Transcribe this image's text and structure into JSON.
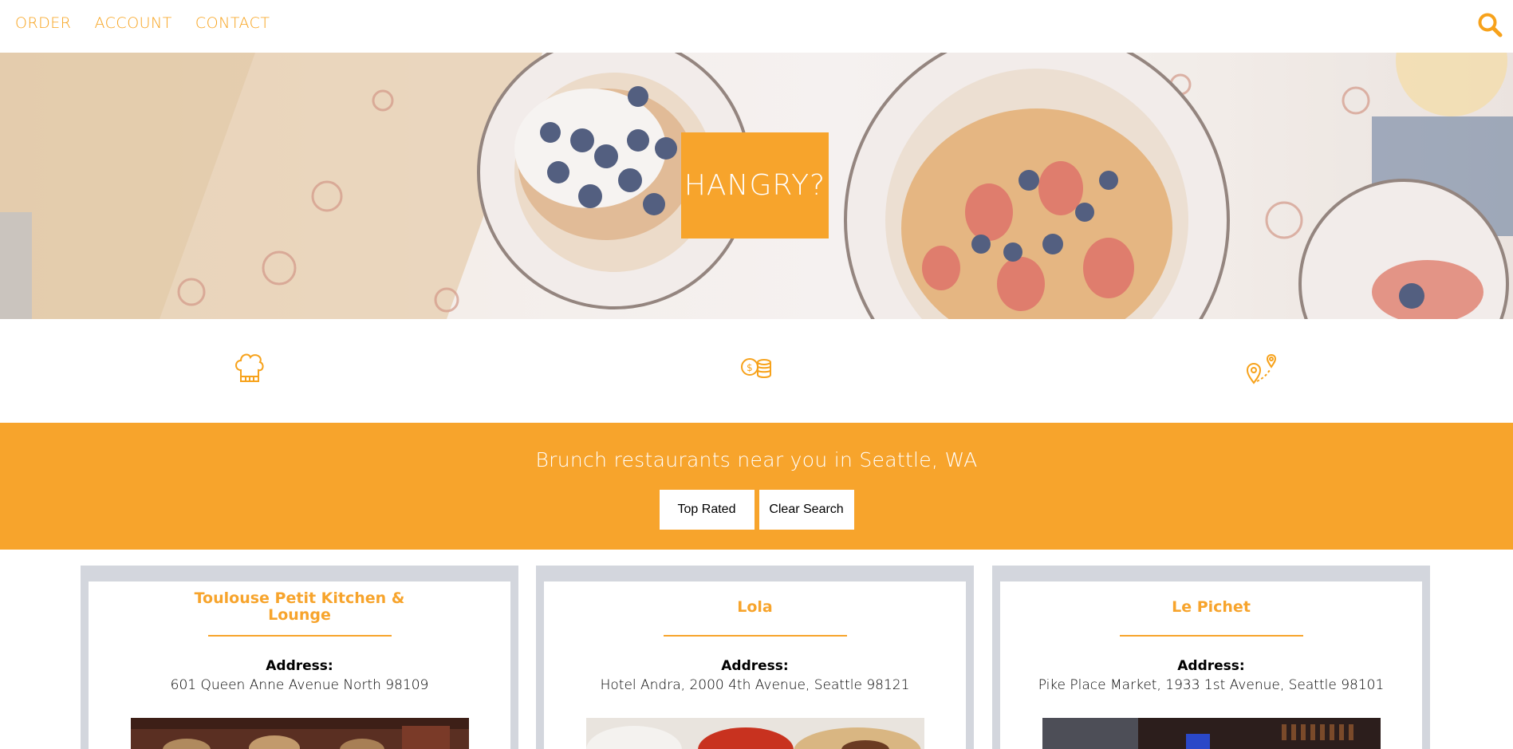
{
  "nav": {
    "links": [
      "ORDER",
      "ACCOUNT",
      "CONTACT"
    ],
    "search_icon": "search-icon",
    "accent": "#f7a21b"
  },
  "hero": {
    "title": "HANGRY?",
    "image": "brunch-waffles-photo",
    "badge_color": "#f7a42c"
  },
  "features": {
    "icons": [
      "chef-hat-icon",
      "coins-icon",
      "location-route-icon"
    ]
  },
  "banner": {
    "heading": "Brunch restaurants near you in Seattle, WA",
    "buttons": [
      "Top Rated",
      "Clear Search"
    ],
    "background": "#f7a42c"
  },
  "restaurants": [
    {
      "name": "Toulouse Petit Kitchen & Lounge",
      "address_label": "Address:",
      "address": "601 Queen Anne Avenue North 98109",
      "photo": "restaurant-interior-photo"
    },
    {
      "name": "Lola",
      "address_label": "Address:",
      "address": "Hotel Andra, 2000 4th Avenue, Seattle 98121",
      "photo": "food-plates-photo"
    },
    {
      "name": "Le Pichet",
      "address_label": "Address:",
      "address": "Pike Place Market, 1933 1st Avenue, Seattle 98101",
      "photo": "bar-interior-photo"
    }
  ]
}
